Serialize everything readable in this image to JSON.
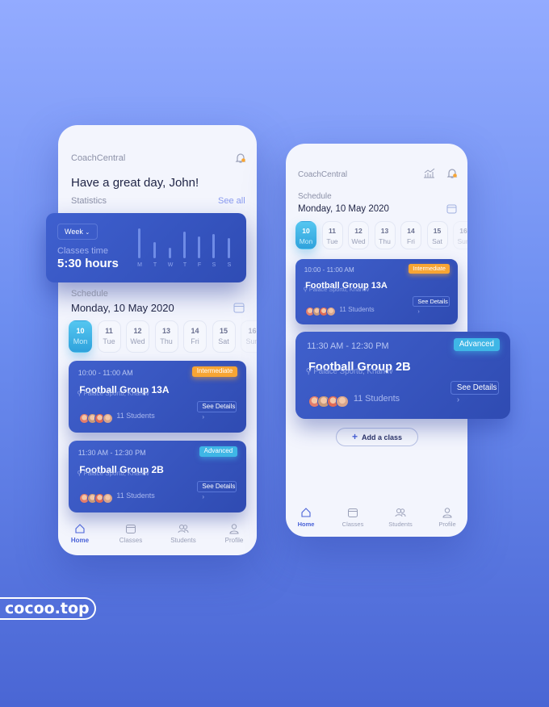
{
  "watermark": "cocoo.top",
  "colors": {
    "accent": "#4a63d8",
    "card": "#3755c0",
    "selected_day": "#42b8e8",
    "intermediate": "#f7a534",
    "advanced": "#3fb6e6"
  },
  "phone1": {
    "app_title": "CoachCentral",
    "greeting": "Have a great day, John!",
    "statistics_label": "Statistics",
    "see_all": "See all",
    "stats": {
      "period": "Week",
      "label": "Classes time",
      "value": "5:30 hours",
      "bars": [
        {
          "day": "M",
          "level": 1.0
        },
        {
          "day": "T",
          "level": 0.54
        },
        {
          "day": "W",
          "level": 0.35
        },
        {
          "day": "T",
          "level": 0.89
        },
        {
          "day": "F",
          "level": 0.73
        },
        {
          "day": "S",
          "level": 0.81
        },
        {
          "day": "S",
          "level": 0.68
        }
      ]
    },
    "schedule_label": "Schedule",
    "date": "Monday, 10 May 2020"
  },
  "phone2": {
    "app_title": "CoachCentral",
    "schedule_label": "Schedule",
    "date": "Monday, 10 May 2020",
    "add_class": "Add a class"
  },
  "days": [
    {
      "num": "10",
      "wd": "Mon",
      "selected": true
    },
    {
      "num": "11",
      "wd": "Tue"
    },
    {
      "num": "12",
      "wd": "Wed"
    },
    {
      "num": "13",
      "wd": "Thu"
    },
    {
      "num": "14",
      "wd": "Fri"
    },
    {
      "num": "15",
      "wd": "Sat"
    },
    {
      "num": "16",
      "wd": "Sun"
    }
  ],
  "classes": [
    {
      "time": "10:00 - 11:00 AM",
      "level": "Intermediate",
      "title": "Football Group 13A",
      "location": "Palace Sportu, Kharkiv",
      "students": "11 Students",
      "details": "See Details"
    },
    {
      "time": "11:30 AM - 12:30 PM",
      "level": "Advanced",
      "title": "Football Group 2B",
      "location": "Palace Sportu, Kharkiv",
      "students": "11 Students",
      "details": "See Details"
    }
  ],
  "nav": [
    {
      "label": "Home",
      "icon": "home-icon",
      "active": true
    },
    {
      "label": "Classes",
      "icon": "calendar-icon"
    },
    {
      "label": "Students",
      "icon": "users-icon"
    },
    {
      "label": "Profile",
      "icon": "user-icon"
    }
  ]
}
